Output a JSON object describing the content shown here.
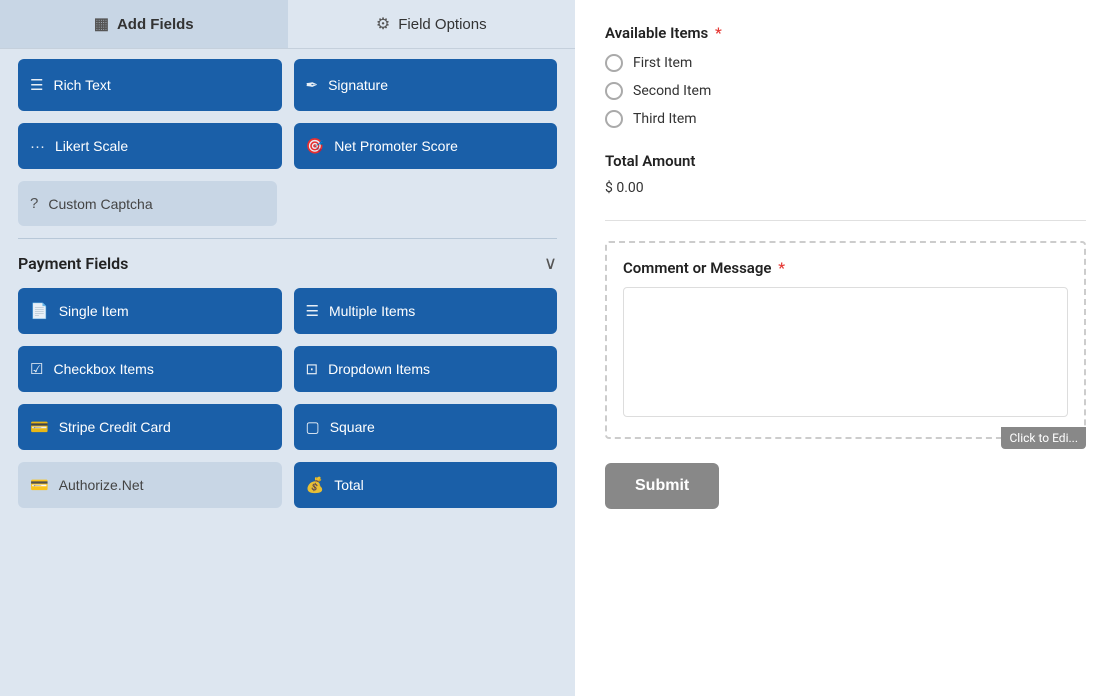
{
  "tabs": [
    {
      "id": "add-fields",
      "label": "Add Fields",
      "icon": "▦",
      "active": true
    },
    {
      "id": "field-options",
      "label": "Field Options",
      "icon": "≡",
      "active": false
    }
  ],
  "partial_buttons": [
    {
      "id": "rich-text",
      "label": "Rich Text",
      "icon": "≡"
    },
    {
      "id": "signature",
      "label": "Signature",
      "icon": "✒"
    }
  ],
  "row2_buttons": [
    {
      "id": "likert-scale",
      "label": "Likert Scale",
      "icon": "···"
    },
    {
      "id": "net-promoter-score",
      "label": "Net Promoter Score",
      "icon": "🎯"
    }
  ],
  "row3_buttons": [
    {
      "id": "custom-captcha",
      "label": "Custom Captcha",
      "icon": "?"
    }
  ],
  "payment_section": {
    "title": "Payment Fields",
    "chevron": "∨"
  },
  "payment_buttons": [
    [
      {
        "id": "single-item",
        "label": "Single Item",
        "icon": "📄"
      },
      {
        "id": "multiple-items",
        "label": "Multiple Items",
        "icon": "☰"
      }
    ],
    [
      {
        "id": "checkbox-items",
        "label": "Checkbox Items",
        "icon": "☑"
      },
      {
        "id": "dropdown-items",
        "label": "Dropdown Items",
        "icon": "⊡"
      }
    ],
    [
      {
        "id": "stripe-credit-card",
        "label": "Stripe Credit Card",
        "icon": "💳"
      },
      {
        "id": "square",
        "label": "Square",
        "icon": "▢"
      }
    ],
    [
      {
        "id": "authorize-net",
        "label": "Authorize.Net",
        "icon": "💳",
        "light": true
      },
      {
        "id": "total",
        "label": "Total",
        "icon": "💰"
      }
    ]
  ],
  "form": {
    "available_items_label": "Available Items",
    "required_star": "*",
    "radio_items": [
      "First Item",
      "Second Item",
      "Third Item"
    ],
    "total_amount_label": "Total Amount",
    "total_value": "$ 0.00",
    "comment_label": "Comment or Message",
    "click_to_edit": "Click to Edi...",
    "submit_label": "Submit"
  }
}
